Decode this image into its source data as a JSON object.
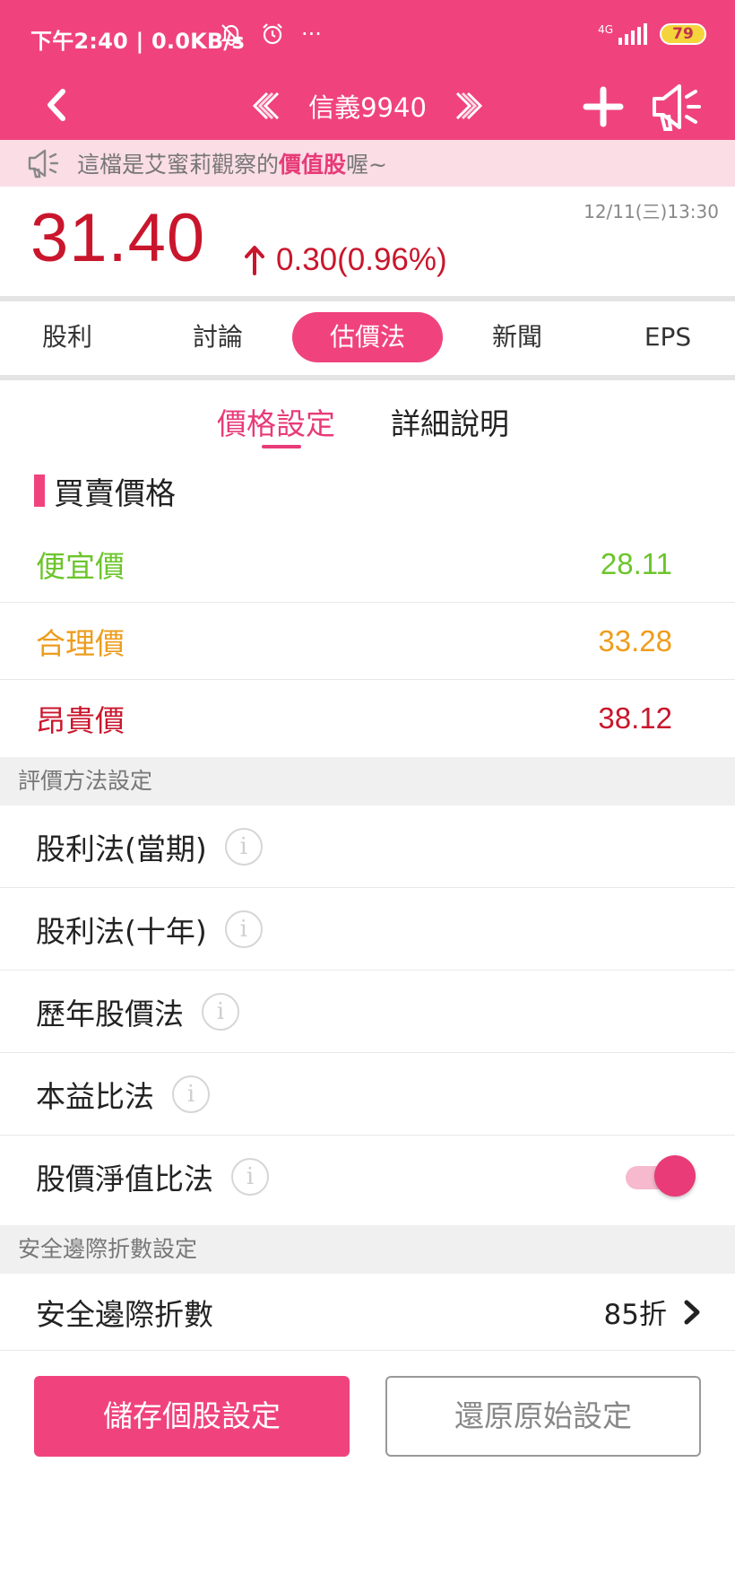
{
  "status_bar": {
    "time": "下午2:40",
    "speed": "0.0KB/s",
    "more": "···",
    "network": "4G",
    "battery": "79"
  },
  "nav": {
    "title": "信義9940",
    "icons": [
      "back-icon",
      "double-chevron-left-icon",
      "double-chevron-right-icon",
      "plus-icon",
      "speaker-icon"
    ]
  },
  "notice": {
    "prefix": "這檔是艾蜜莉觀察的",
    "highlight": "價值股",
    "suffix": "喔~"
  },
  "quote": {
    "price": "31.40",
    "change": "0.30(0.96%)",
    "datetime": "12/11(三)13:30"
  },
  "tabs": [
    {
      "label": "股利",
      "active": false
    },
    {
      "label": "討論",
      "active": false
    },
    {
      "label": "估價法",
      "active": true
    },
    {
      "label": "新聞",
      "active": false
    },
    {
      "label": "EPS",
      "active": false
    }
  ],
  "subtabs": [
    {
      "label": "價格設定",
      "active": true
    },
    {
      "label": "詳細說明",
      "active": false
    }
  ],
  "trade_prices": {
    "title": "買賣價格",
    "rows": [
      {
        "label": "便宜價",
        "value": "28.11",
        "color": "#6cc52b"
      },
      {
        "label": "合理價",
        "value": "33.28",
        "color": "#ee9d1c"
      },
      {
        "label": "昂貴價",
        "value": "38.12",
        "color": "#c9162c"
      }
    ]
  },
  "methods": {
    "header": "評價方法設定",
    "items": [
      {
        "label": "股利法(當期)",
        "info": "i"
      },
      {
        "label": "股利法(十年)",
        "info": "i"
      },
      {
        "label": "歷年股價法",
        "info": "i"
      },
      {
        "label": "本益比法",
        "info": "i"
      },
      {
        "label": "股價淨值比法",
        "info": "i",
        "toggle_on": true
      }
    ]
  },
  "safety": {
    "header": "安全邊際折數設定",
    "label": "安全邊際折數",
    "value": "85折"
  },
  "buttons": {
    "save": "儲存個股設定",
    "reset": "還原原始設定"
  },
  "colors": {
    "brand": "#f0437e",
    "up": "#c9162c"
  }
}
